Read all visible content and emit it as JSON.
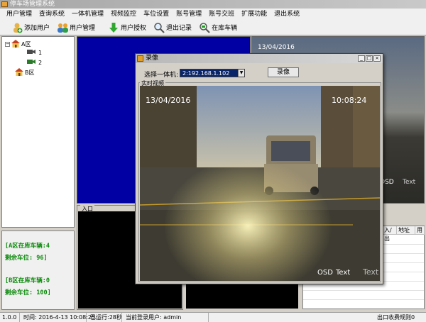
{
  "app": {
    "title": "停车场管理系统"
  },
  "menu": [
    "用户管理",
    "查询系统",
    "一体机管理",
    "视频监控",
    "车位设置",
    "账号管理",
    "账号交班",
    "扩展功能",
    "退出系统"
  ],
  "toolbar": {
    "add_user": "添加用户",
    "user_manage": "用户管理",
    "user_grant": "用户授权",
    "logout_record": "退出记录",
    "cars_in_lot": "在库车辆"
  },
  "tree": {
    "zone_a": "A区",
    "cam1": "1",
    "cam2": "2",
    "zone_b": "B区"
  },
  "stats": {
    "a_in_lot": "[A区在库车辆:4",
    "a_remaining": "剩余车位: 96]",
    "b_in_lot": "[B区在库车辆:0",
    "b_remaining": "剩余车位: 100]"
  },
  "panes": {
    "entry_label": "入口",
    "top_right_date": "13/04/2016",
    "osd_text": "OSD",
    "osd_text2": "Text"
  },
  "log_table": {
    "columns": [
      "",
      "入/出",
      "地址",
      "用"
    ]
  },
  "status": {
    "version": "1.0.0",
    "time": "时间: 2016-4-13 10:08:25",
    "running": "已运行:28秒",
    "user": "当前登录用户: admin",
    "rules": "出口收费规则0"
  },
  "dialog": {
    "title": "录像",
    "select_label": "选择一体机:",
    "selected_device": "2:192.168.1.102",
    "record_button": "录像",
    "live_label": "实时视频",
    "video_date": "13/04/2016",
    "video_time": "10:08:24",
    "osd1": "OSD",
    "osd2": "Text",
    "osd3": "Text"
  },
  "colors": {
    "stats_text": "#0b8a0b",
    "pane_blue": "#0000a3",
    "select_highlight": "#0a246a"
  }
}
